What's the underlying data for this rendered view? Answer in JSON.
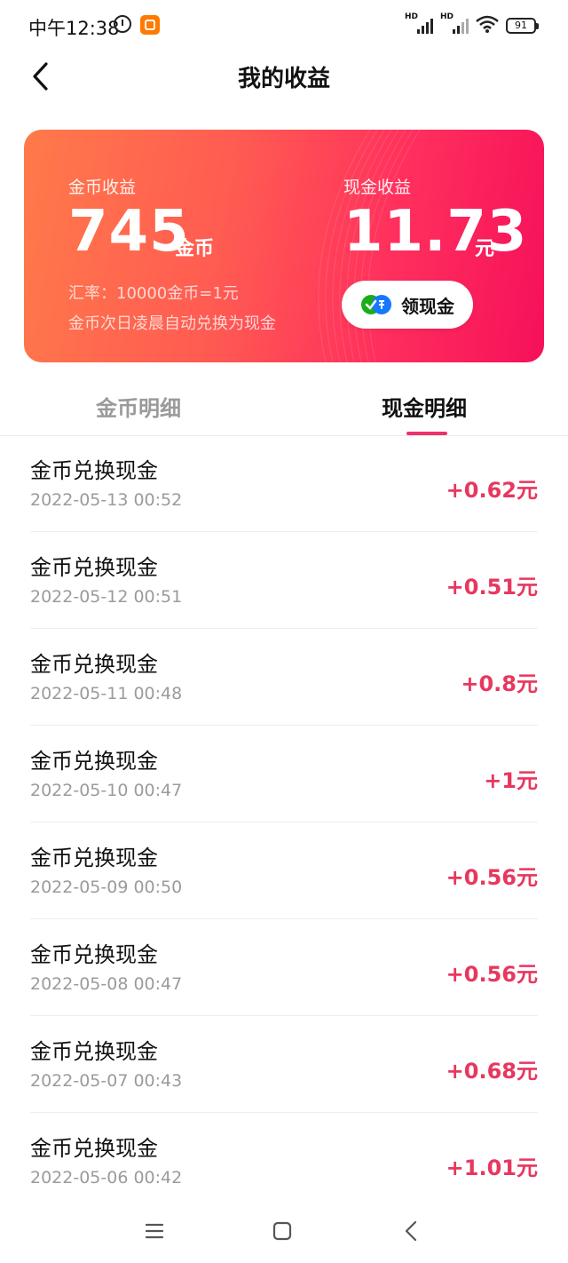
{
  "status_bar": {
    "time": "中午12:38",
    "battery": "91",
    "hd1": "HD",
    "hd2": "HD"
  },
  "header": {
    "title": "我的收益"
  },
  "card": {
    "coin_label": "金币收益",
    "coin_value": "745",
    "coin_unit": "金币",
    "rate": "汇率：10000金币=1元",
    "auto_convert": "金币次日凌晨自动兑换为现金",
    "cash_label": "现金收益",
    "cash_value": "11.73",
    "cash_unit": "元",
    "withdraw_label": "领现金"
  },
  "tabs": {
    "coin": "金币明细",
    "cash": "现金明细",
    "active": "cash"
  },
  "records": [
    {
      "title": "金币兑换现金",
      "time": "2022-05-13 00:52",
      "amount": "+0.62元"
    },
    {
      "title": "金币兑换现金",
      "time": "2022-05-12 00:51",
      "amount": "+0.51元"
    },
    {
      "title": "金币兑换现金",
      "time": "2022-05-11 00:48",
      "amount": "+0.8元"
    },
    {
      "title": "金币兑换现金",
      "time": "2022-05-10 00:47",
      "amount": "+1元"
    },
    {
      "title": "金币兑换现金",
      "time": "2022-05-09 00:50",
      "amount": "+0.56元"
    },
    {
      "title": "金币兑换现金",
      "time": "2022-05-08 00:47",
      "amount": "+0.56元"
    },
    {
      "title": "金币兑换现金",
      "time": "2022-05-07 00:43",
      "amount": "+0.68元"
    },
    {
      "title": "金币兑换现金",
      "time": "2022-05-06 00:42",
      "amount": "+1.01元"
    }
  ],
  "colors": {
    "accent": "#f0306a",
    "amount": "#e8375f",
    "card_start": "#ff7a4a",
    "card_end": "#f5105a"
  },
  "icons": {
    "back": "chevron-left-icon",
    "withdraw": "wechat-pay-icon",
    "nav_menu": "menu-icon",
    "nav_home": "square-icon",
    "nav_back": "chevron-left-icon"
  }
}
